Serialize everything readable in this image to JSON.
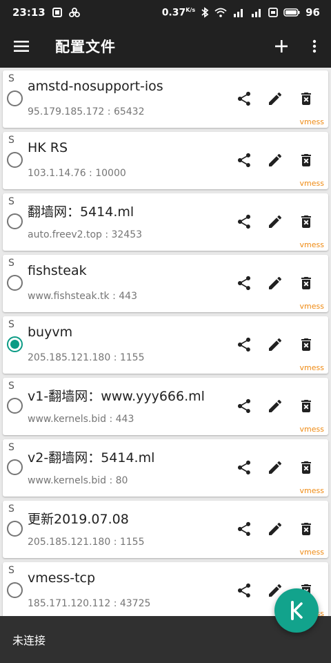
{
  "status_bar": {
    "time": "23:13",
    "net_speed": "0.37",
    "net_speed_unit": "K/s",
    "battery": "96"
  },
  "app_bar": {
    "title": "配置文件",
    "icons": [
      "menu-icon",
      "add-icon",
      "more-vert-icon"
    ]
  },
  "servers": [
    {
      "tag": "S",
      "name": "amstd-nosupport-ios",
      "address": "95.179.185.172 : 65432",
      "type": "vmess",
      "selected": false
    },
    {
      "tag": "S",
      "name": "HK RS",
      "address": "103.1.14.76 : 10000",
      "type": "vmess",
      "selected": false
    },
    {
      "tag": "S",
      "name": "翻墙网：5414.ml",
      "address": "auto.freev2.top : 32453",
      "type": "vmess",
      "selected": false
    },
    {
      "tag": "S",
      "name": "fishsteak",
      "address": "www.fishsteak.tk : 443",
      "type": "vmess",
      "selected": false
    },
    {
      "tag": "S",
      "name": "buyvm",
      "address": "205.185.121.180 : 1155",
      "type": "vmess",
      "selected": true
    },
    {
      "tag": "S",
      "name": "v1-翻墙网：www.yyy666.ml",
      "address": "www.kernels.bid : 443",
      "type": "vmess",
      "selected": false
    },
    {
      "tag": "S",
      "name": "v2-翻墙网：5414.ml",
      "address": "www.kernels.bid : 80",
      "type": "vmess",
      "selected": false
    },
    {
      "tag": "S",
      "name": "更新2019.07.08",
      "address": "205.185.121.180 : 1155",
      "type": "vmess",
      "selected": false
    },
    {
      "tag": "S",
      "name": "vmess-tcp",
      "address": "185.171.120.112 : 43725",
      "type": "vmess",
      "selected": false
    }
  ],
  "row_icons": [
    "share-icon",
    "edit-icon",
    "delete-icon"
  ],
  "bottom_bar": {
    "status": "未连接"
  },
  "fab": {
    "icon": "connect-toggle-icon"
  },
  "colors": {
    "toolbar": "#212121",
    "accent": "#12a38c",
    "type_label": "#ef8a12",
    "bottom_bar": "#303030"
  }
}
